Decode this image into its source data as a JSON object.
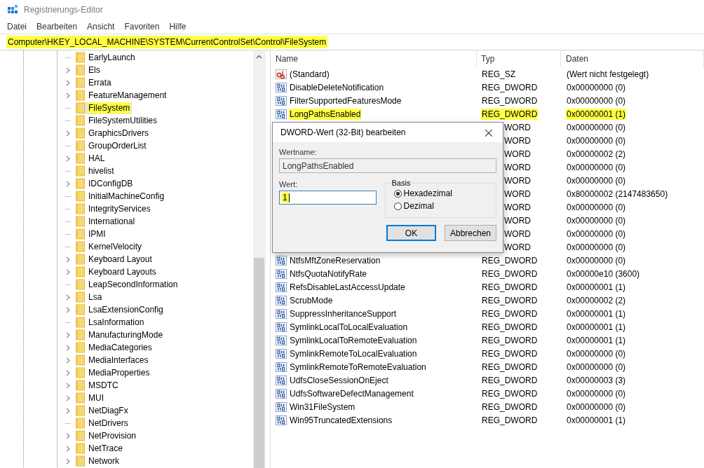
{
  "window": {
    "title": "Registrierungs-Editor"
  },
  "menu": [
    "Datei",
    "Bearbeiten",
    "Ansicht",
    "Favoriten",
    "Hilfe"
  ],
  "address_bar": {
    "path": "Computer\\HKEY_LOCAL_MACHINE\\SYSTEM\\CurrentControlSet\\Control\\FileSystem",
    "highlighted": true
  },
  "tree": {
    "items": [
      {
        "label": "EarlyLaunch",
        "kind": "leaf",
        "selected": false,
        "highlighted": false
      },
      {
        "label": "Els",
        "kind": "branch",
        "selected": false,
        "highlighted": false
      },
      {
        "label": "Errata",
        "kind": "branch",
        "selected": false,
        "highlighted": false
      },
      {
        "label": "FeatureManagement",
        "kind": "branch",
        "selected": false,
        "highlighted": false
      },
      {
        "label": "FileSystem",
        "kind": "leaf",
        "selected": true,
        "highlighted": true
      },
      {
        "label": "FileSystemUtilities",
        "kind": "leaf",
        "selected": false,
        "highlighted": false
      },
      {
        "label": "GraphicsDrivers",
        "kind": "branch",
        "selected": false,
        "highlighted": false
      },
      {
        "label": "GroupOrderList",
        "kind": "leaf",
        "selected": false,
        "highlighted": false
      },
      {
        "label": "HAL",
        "kind": "branch",
        "selected": false,
        "highlighted": false
      },
      {
        "label": "hivelist",
        "kind": "leaf",
        "selected": false,
        "highlighted": false
      },
      {
        "label": "IDConfigDB",
        "kind": "branch",
        "selected": false,
        "highlighted": false
      },
      {
        "label": "InitialMachineConfig",
        "kind": "leaf",
        "selected": false,
        "highlighted": false
      },
      {
        "label": "IntegrityServices",
        "kind": "leaf",
        "selected": false,
        "highlighted": false
      },
      {
        "label": "International",
        "kind": "leaf",
        "selected": false,
        "highlighted": false
      },
      {
        "label": "IPMI",
        "kind": "leaf",
        "selected": false,
        "highlighted": false
      },
      {
        "label": "KernelVelocity",
        "kind": "leaf",
        "selected": false,
        "highlighted": false
      },
      {
        "label": "Keyboard Layout",
        "kind": "branch",
        "selected": false,
        "highlighted": false
      },
      {
        "label": "Keyboard Layouts",
        "kind": "branch",
        "selected": false,
        "highlighted": false
      },
      {
        "label": "LeapSecondInformation",
        "kind": "leaf",
        "selected": false,
        "highlighted": false
      },
      {
        "label": "Lsa",
        "kind": "branch",
        "selected": false,
        "highlighted": false
      },
      {
        "label": "LsaExtensionConfig",
        "kind": "branch",
        "selected": false,
        "highlighted": false
      },
      {
        "label": "LsaInformation",
        "kind": "leaf",
        "selected": false,
        "highlighted": false
      },
      {
        "label": "ManufacturingMode",
        "kind": "branch",
        "selected": false,
        "highlighted": false
      },
      {
        "label": "MediaCategories",
        "kind": "branch",
        "selected": false,
        "highlighted": false
      },
      {
        "label": "MediaInterfaces",
        "kind": "branch",
        "selected": false,
        "highlighted": false
      },
      {
        "label": "MediaProperties",
        "kind": "branch",
        "selected": false,
        "highlighted": false
      },
      {
        "label": "MSDTC",
        "kind": "branch",
        "selected": false,
        "highlighted": false
      },
      {
        "label": "MUI",
        "kind": "branch",
        "selected": false,
        "highlighted": false
      },
      {
        "label": "NetDiagFx",
        "kind": "branch",
        "selected": false,
        "highlighted": false
      },
      {
        "label": "NetDrivers",
        "kind": "leaf",
        "selected": false,
        "highlighted": false
      },
      {
        "label": "NetProvision",
        "kind": "branch",
        "selected": false,
        "highlighted": false
      },
      {
        "label": "NetTrace",
        "kind": "branch",
        "selected": false,
        "highlighted": false
      },
      {
        "label": "Network",
        "kind": "branch",
        "selected": false,
        "highlighted": false
      }
    ]
  },
  "table": {
    "columns": [
      "Name",
      "Typ",
      "Daten"
    ],
    "rows": [
      {
        "kind": "string",
        "name": "(Standard)",
        "type": "REG_SZ",
        "data": "(Wert nicht festgelegt)",
        "highlighted": false
      },
      {
        "kind": "dword",
        "name": "DisableDeleteNotification",
        "type": "REG_DWORD",
        "data": "0x00000000 (0)",
        "highlighted": false
      },
      {
        "kind": "dword",
        "name": "FilterSupportedFeaturesMode",
        "type": "REG_DWORD",
        "data": "0x00000000 (0)",
        "highlighted": false
      },
      {
        "kind": "dword",
        "name": "LongPathsEnabled",
        "type": "REG_DWORD",
        "data": "0x00000001 (1)",
        "highlighted": true
      },
      {
        "kind": "covered",
        "type": "WORD",
        "data": "0x00000000 (0)"
      },
      {
        "kind": "covered",
        "type": "WORD",
        "data": "0x00000000 (0)"
      },
      {
        "kind": "covered",
        "type": "WORD",
        "data": "0x00000002 (2)"
      },
      {
        "kind": "covered",
        "type": "WORD",
        "data": "0x00000000 (0)"
      },
      {
        "kind": "covered",
        "type": "WORD",
        "data": "0x00000000 (0)"
      },
      {
        "kind": "covered",
        "type": "WORD",
        "data": "0x80000002 (2147483650)"
      },
      {
        "kind": "covered",
        "type": "WORD",
        "data": "0x00000000 (0)"
      },
      {
        "kind": "covered",
        "type": "WORD",
        "data": "0x00000000 (0)"
      },
      {
        "kind": "covered",
        "type": "WORD",
        "data": "0x00000000 (0)"
      },
      {
        "kind": "covered",
        "type": "WORD",
        "data": "0x00000000 (0)"
      },
      {
        "kind": "dword",
        "name": "NtfsMftZoneReservation",
        "type": "REG_DWORD",
        "data": "0x00000000 (0)",
        "highlighted": false
      },
      {
        "kind": "dword",
        "name": "NtfsQuotaNotifyRate",
        "type": "REG_DWORD",
        "data": "0x00000e10 (3600)",
        "highlighted": false
      },
      {
        "kind": "dword",
        "name": "RefsDisableLastAccessUpdate",
        "type": "REG_DWORD",
        "data": "0x00000001 (1)",
        "highlighted": false
      },
      {
        "kind": "dword",
        "name": "ScrubMode",
        "type": "REG_DWORD",
        "data": "0x00000002 (2)",
        "highlighted": false
      },
      {
        "kind": "dword",
        "name": "SuppressInheritanceSupport",
        "type": "REG_DWORD",
        "data": "0x00000001 (1)",
        "highlighted": false
      },
      {
        "kind": "dword",
        "name": "SymlinkLocalToLocalEvaluation",
        "type": "REG_DWORD",
        "data": "0x00000001 (1)",
        "highlighted": false
      },
      {
        "kind": "dword",
        "name": "SymlinkLocalToRemoteEvaluation",
        "type": "REG_DWORD",
        "data": "0x00000001 (1)",
        "highlighted": false
      },
      {
        "kind": "dword",
        "name": "SymlinkRemoteToLocalEvaluation",
        "type": "REG_DWORD",
        "data": "0x00000000 (0)",
        "highlighted": false
      },
      {
        "kind": "dword",
        "name": "SymlinkRemoteToRemoteEvaluation",
        "type": "REG_DWORD",
        "data": "0x00000000 (0)",
        "highlighted": false
      },
      {
        "kind": "dword",
        "name": "UdfsCloseSessionOnEject",
        "type": "REG_DWORD",
        "data": "0x00000003 (3)",
        "highlighted": false
      },
      {
        "kind": "dword",
        "name": "UdfsSoftwareDefectManagement",
        "type": "REG_DWORD",
        "data": "0x00000000 (0)",
        "highlighted": false
      },
      {
        "kind": "dword",
        "name": "Win31FileSystem",
        "type": "REG_DWORD",
        "data": "0x00000000 (0)",
        "highlighted": false
      },
      {
        "kind": "dword",
        "name": "Win95TruncatedExtensions",
        "type": "REG_DWORD",
        "data": "0x00000001 (1)",
        "highlighted": false
      }
    ]
  },
  "dialog": {
    "title": "DWORD-Wert (32-Bit) bearbeiten",
    "close": "×",
    "name_label": "Wertname:",
    "name_value": "LongPathsEnabled",
    "value_label": "Wert:",
    "value": "1",
    "value_highlighted": true,
    "base_group": "Basis",
    "bases": [
      {
        "label": "Hexadezimal",
        "selected": true
      },
      {
        "label": "Dezimal",
        "selected": false
      }
    ],
    "buttons": [
      "OK",
      "Abbrechen"
    ]
  }
}
